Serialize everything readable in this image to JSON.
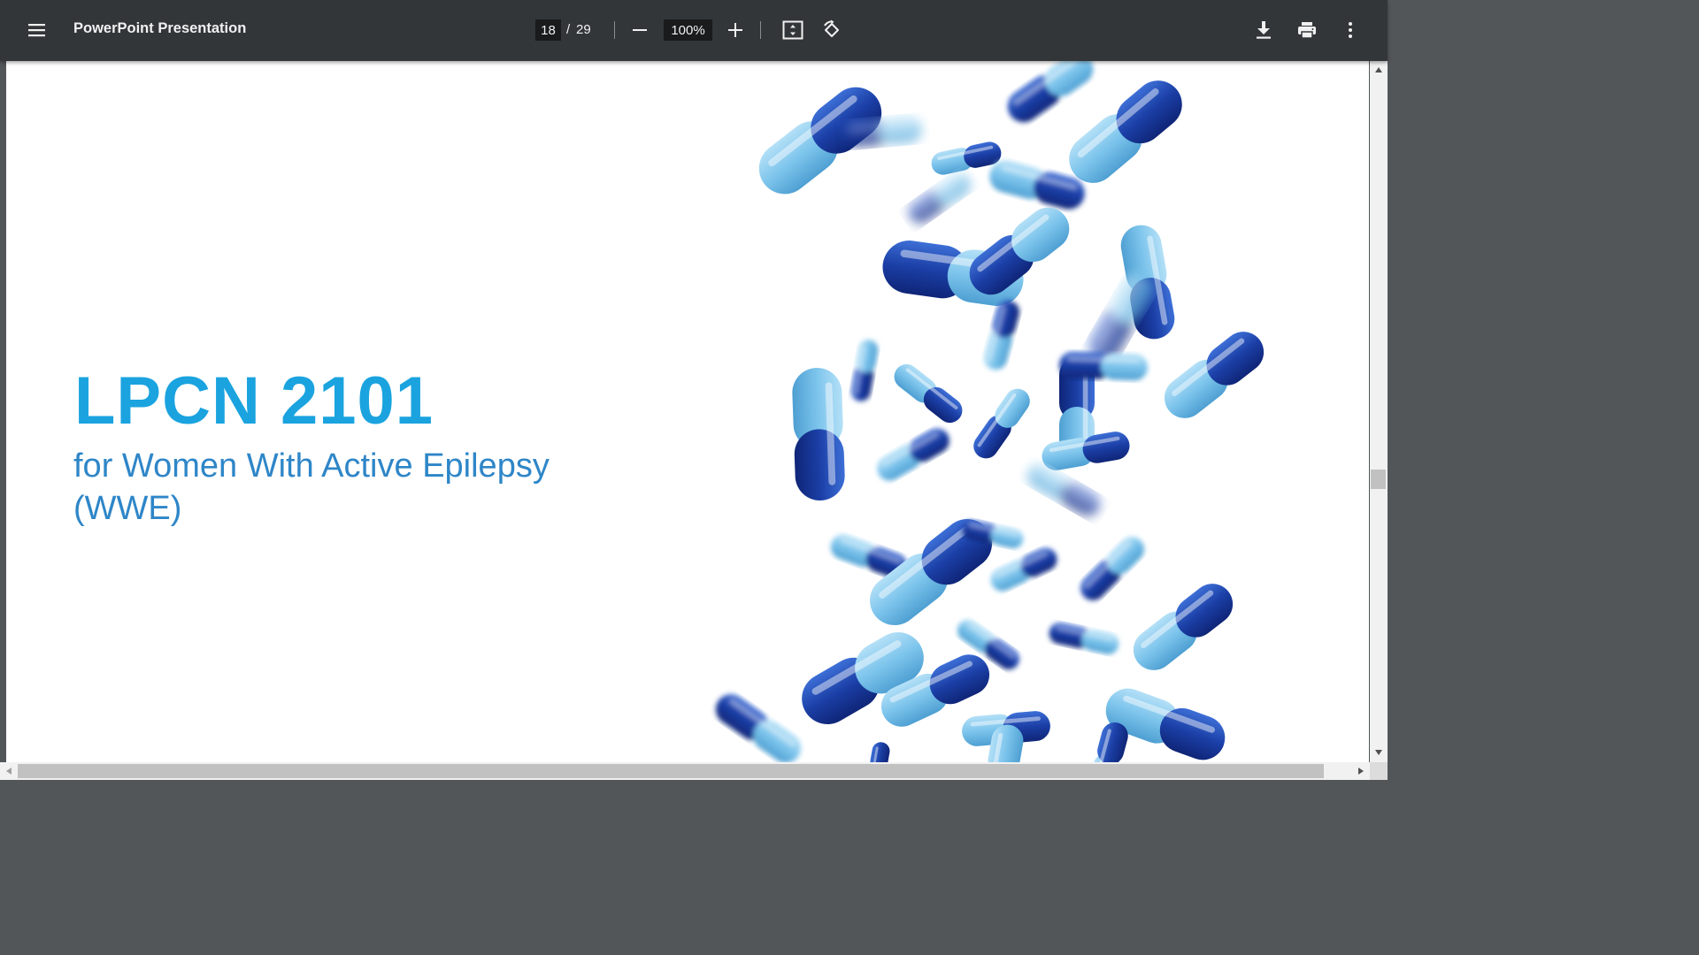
{
  "toolbar": {
    "title": "PowerPoint Presentation",
    "current_page": "18",
    "page_separator": "/",
    "total_pages": "29",
    "zoom": "100%"
  },
  "icons": [
    "menu-icon",
    "minus-icon",
    "plus-icon",
    "fit-to-page-icon",
    "rotate-icon",
    "download-icon",
    "print-icon",
    "more-vert-icon"
  ],
  "slide": {
    "title": "LPCN 2101",
    "subtitle": "for Women With Active Epilepsy (WWE)"
  },
  "colors": {
    "toolbar_bg": "#323639",
    "title": "#1aa3df",
    "subtitle": "#2e86c8",
    "capsule_dark": "#1b3fa6",
    "capsule_light": "#7cc4ec"
  }
}
